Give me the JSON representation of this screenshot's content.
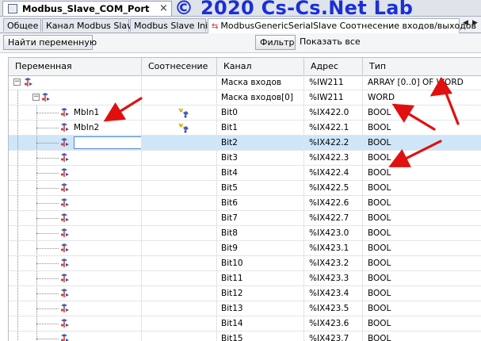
{
  "window": {
    "doc_title": "Modbus_Slave_COM_Port",
    "doc_close_glyph": "×",
    "watermark": "© 2020 Cs-Cs.Net Lab"
  },
  "tabs": [
    {
      "label": "Общее",
      "active": false
    },
    {
      "label": "Канал Modbus Slave",
      "active": false
    },
    {
      "label": "Modbus Slave Init",
      "active": false
    },
    {
      "label": "ModbusGenericSerialSlave Соотнесение входов/выходов",
      "active": true
    }
  ],
  "tab_scroll": {
    "left": "◀",
    "right": "▶"
  },
  "toolbar": {
    "find_label": "Найти переменную",
    "filter_label": "Фильтр",
    "filter_value": "Показать все"
  },
  "columns": {
    "variable": "Переменная",
    "mapping": "Соотнесение",
    "channel": "Канал",
    "address": "Адрес",
    "type": "Тип"
  },
  "rows": [
    {
      "variable": "",
      "channel": "Маска входов",
      "address": "%IW211",
      "type": "ARRAY [0..0] OF WORD"
    },
    {
      "variable": "",
      "channel": "Маска входов[0]",
      "address": "%IW211",
      "type": "WORD"
    },
    {
      "variable": "MbIn1",
      "channel": "Bit0",
      "address": "%IX422.0",
      "type": "BOOL"
    },
    {
      "variable": "MbIn2",
      "channel": "Bit1",
      "address": "%IX422.1",
      "type": "BOOL"
    },
    {
      "variable": "",
      "channel": "Bit2",
      "address": "%IX422.2",
      "type": "BOOL"
    },
    {
      "variable": "",
      "channel": "Bit3",
      "address": "%IX422.3",
      "type": "BOOL"
    },
    {
      "variable": "",
      "channel": "Bit4",
      "address": "%IX422.4",
      "type": "BOOL"
    },
    {
      "variable": "",
      "channel": "Bit5",
      "address": "%IX422.5",
      "type": "BOOL"
    },
    {
      "variable": "",
      "channel": "Bit6",
      "address": "%IX422.6",
      "type": "BOOL"
    },
    {
      "variable": "",
      "channel": "Bit7",
      "address": "%IX422.7",
      "type": "BOOL"
    },
    {
      "variable": "",
      "channel": "Bit8",
      "address": "%IX423.0",
      "type": "BOOL"
    },
    {
      "variable": "",
      "channel": "Bit9",
      "address": "%IX423.1",
      "type": "BOOL"
    },
    {
      "variable": "",
      "channel": "Bit10",
      "address": "%IX423.2",
      "type": "BOOL"
    },
    {
      "variable": "",
      "channel": "Bit11",
      "address": "%IX423.3",
      "type": "BOOL"
    },
    {
      "variable": "",
      "channel": "Bit12",
      "address": "%IX423.4",
      "type": "BOOL"
    },
    {
      "variable": "",
      "channel": "Bit13",
      "address": "%IX423.5",
      "type": "BOOL"
    },
    {
      "variable": "",
      "channel": "Bit14",
      "address": "%IX423.6",
      "type": "BOOL"
    },
    {
      "variable": "",
      "channel": "Bit15",
      "address": "%IX423.7",
      "type": "BOOL"
    }
  ],
  "icons": {
    "variable": "variable-mapping-icon",
    "mapped": "mapped-variable-icon",
    "tree_collapse": "minus-expander-icon"
  },
  "colors": {
    "watermark": "#1a2fd6",
    "selection": "#cfe6f8",
    "annotation_arrow": "#e01010"
  }
}
